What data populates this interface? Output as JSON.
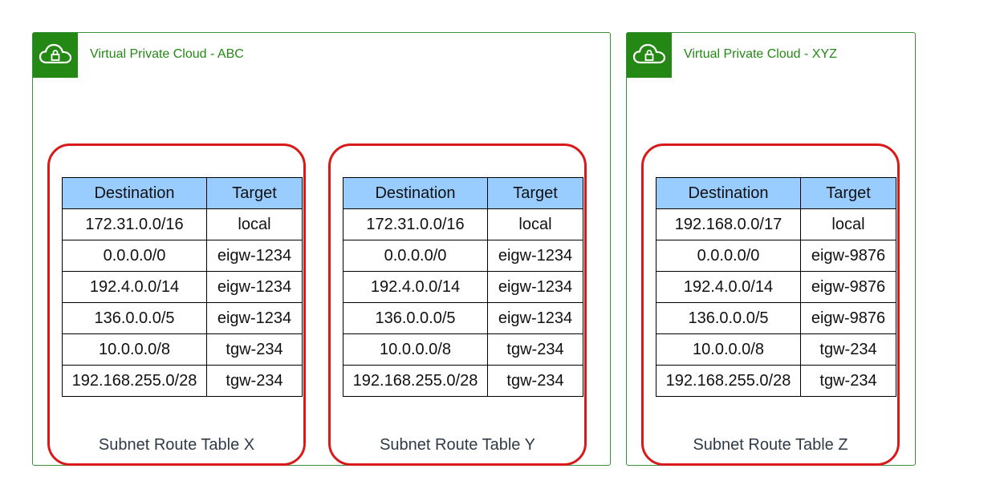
{
  "vpcs": [
    {
      "title": "Virtual Private Cloud - ABC",
      "icon": "cloud-lock-icon",
      "subnets": [
        {
          "label": "Subnet Route Table X",
          "columns": [
            "Destination",
            "Target"
          ],
          "rows": [
            [
              "172.31.0.0/16",
              "local"
            ],
            [
              "0.0.0.0/0",
              "eigw-1234"
            ],
            [
              "192.4.0.0/14",
              "eigw-1234"
            ],
            [
              "136.0.0.0/5",
              "eigw-1234"
            ],
            [
              "10.0.0.0/8",
              "tgw-234"
            ],
            [
              "192.168.255.0/28",
              "tgw-234"
            ]
          ]
        },
        {
          "label": "Subnet Route Table Y",
          "columns": [
            "Destination",
            "Target"
          ],
          "rows": [
            [
              "172.31.0.0/16",
              "local"
            ],
            [
              "0.0.0.0/0",
              "eigw-1234"
            ],
            [
              "192.4.0.0/14",
              "eigw-1234"
            ],
            [
              "136.0.0.0/5",
              "eigw-1234"
            ],
            [
              "10.0.0.0/8",
              "tgw-234"
            ],
            [
              "192.168.255.0/28",
              "tgw-234"
            ]
          ]
        }
      ]
    },
    {
      "title": "Virtual Private Cloud - XYZ",
      "icon": "cloud-lock-icon",
      "subnets": [
        {
          "label": "Subnet Route Table Z",
          "columns": [
            "Destination",
            "Target"
          ],
          "rows": [
            [
              "192.168.0.0/17",
              "local"
            ],
            [
              "0.0.0.0/0",
              "eigw-9876"
            ],
            [
              "192.4.0.0/14",
              "eigw-9876"
            ],
            [
              "136.0.0.0/5",
              "eigw-9876"
            ],
            [
              "10.0.0.0/8",
              "tgw-234"
            ],
            [
              "192.168.255.0/28",
              "tgw-234"
            ]
          ]
        }
      ]
    }
  ],
  "colors": {
    "vpc_border": "#3b8e3b",
    "vpc_icon_bg": "#248814",
    "vpc_title": "#248814",
    "subnet_border": "#d91a1a",
    "table_header_bg": "#99ccff"
  }
}
